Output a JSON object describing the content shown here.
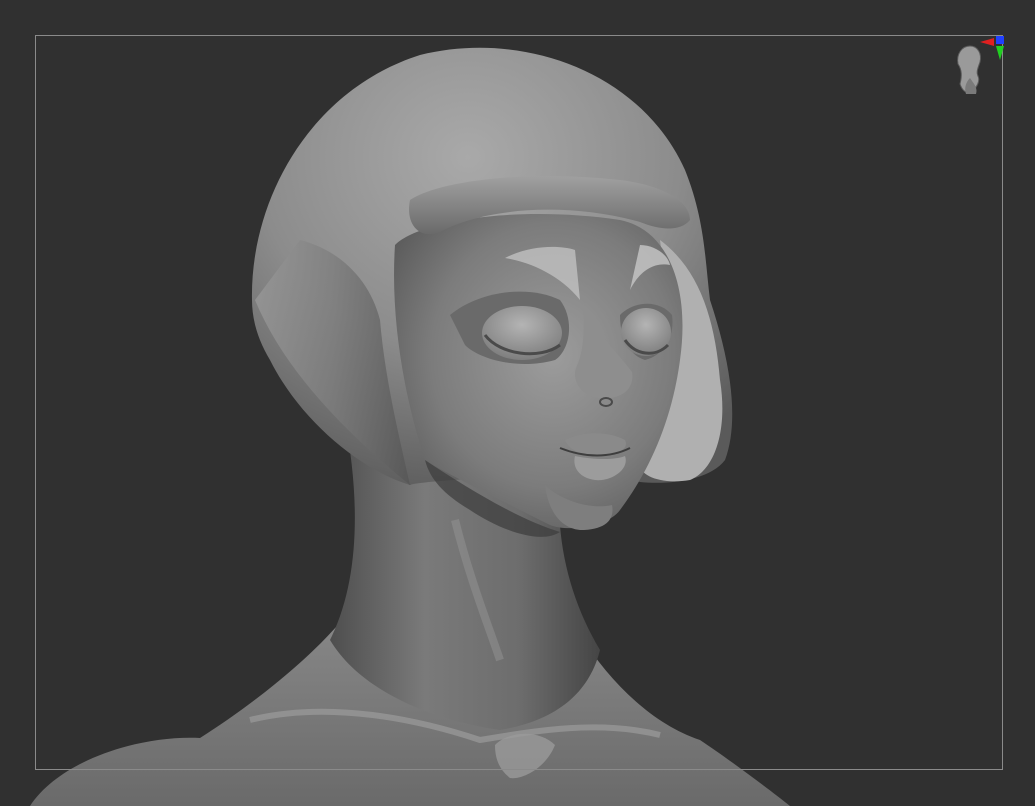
{
  "viewport": {
    "background_color": "#303030",
    "frame_color": "#8a8a8a",
    "content": "sculpted-bust"
  },
  "sculpt": {
    "material_color": "#8a8a8a",
    "shading": "matcap-gray"
  },
  "navigation_widget": {
    "icon": "head-orientation-icon",
    "axis_colors": {
      "x": "#e02020",
      "y": "#20d020",
      "z": "#2040ff"
    }
  }
}
